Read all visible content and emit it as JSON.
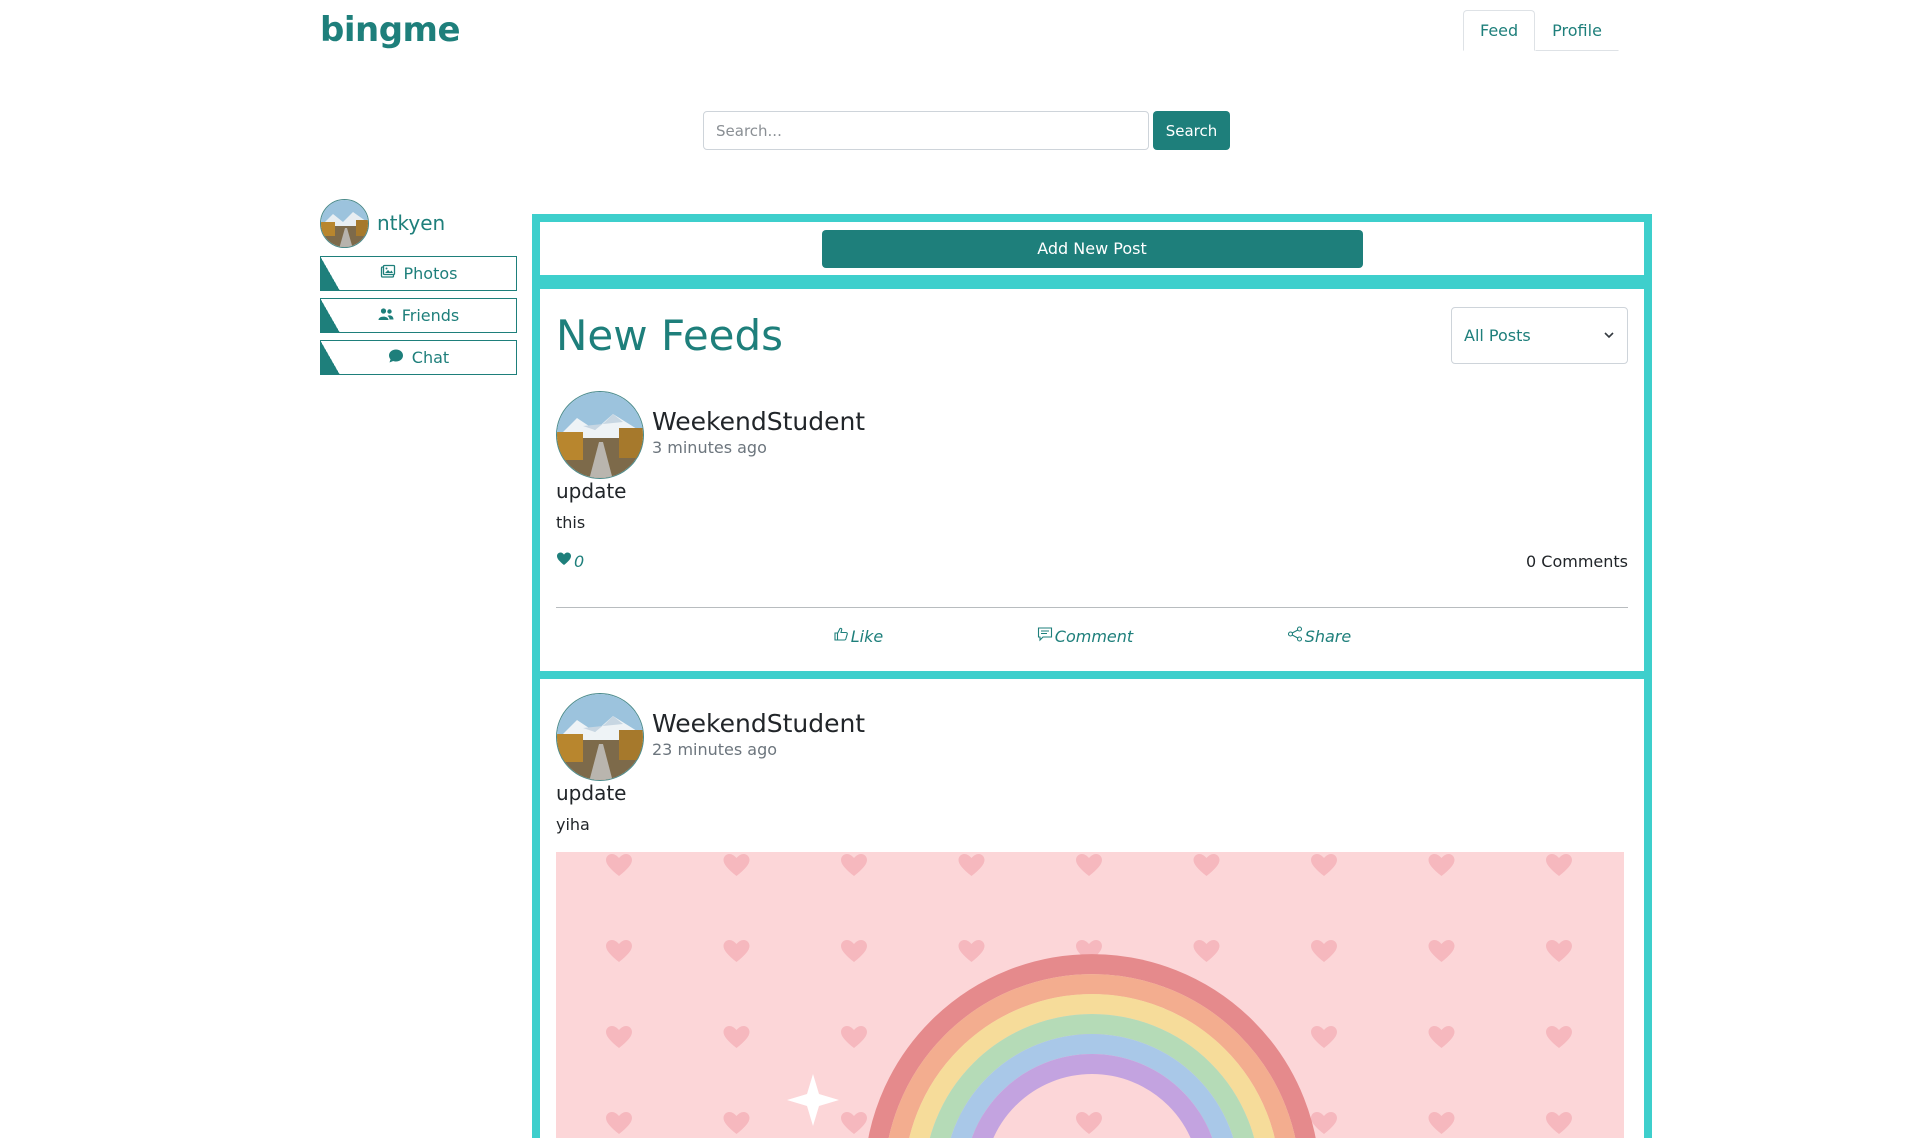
{
  "app": {
    "logo": "bingme"
  },
  "nav": {
    "tabs": [
      {
        "label": "Feed",
        "active": true
      },
      {
        "label": "Profile",
        "active": false
      }
    ]
  },
  "search": {
    "placeholder": "Search...",
    "button_label": "Search"
  },
  "sidebar": {
    "username": "ntkyen",
    "items": [
      {
        "label": "Photos",
        "icon": "photos-icon"
      },
      {
        "label": "Friends",
        "icon": "friends-icon"
      },
      {
        "label": "Chat",
        "icon": "chat-icon"
      }
    ]
  },
  "main": {
    "add_post_label": "Add New Post",
    "feed_title": "New Feeds",
    "filter": {
      "selected": "All Posts"
    },
    "posts": [
      {
        "author": "WeekendStudent",
        "time": "3 minutes ago",
        "title": "update",
        "body": "this",
        "likes": "0",
        "comments": "0 Comments"
      },
      {
        "author": "WeekendStudent",
        "time": "23 minutes ago",
        "title": "update",
        "body": "yiha"
      }
    ],
    "actions": {
      "like": "Like",
      "comment": "Comment",
      "share": "Share"
    }
  },
  "colors": {
    "brand": "#1e7f7b",
    "panel_border": "#3ecfcc",
    "image_bg": "#fcd6d8"
  }
}
